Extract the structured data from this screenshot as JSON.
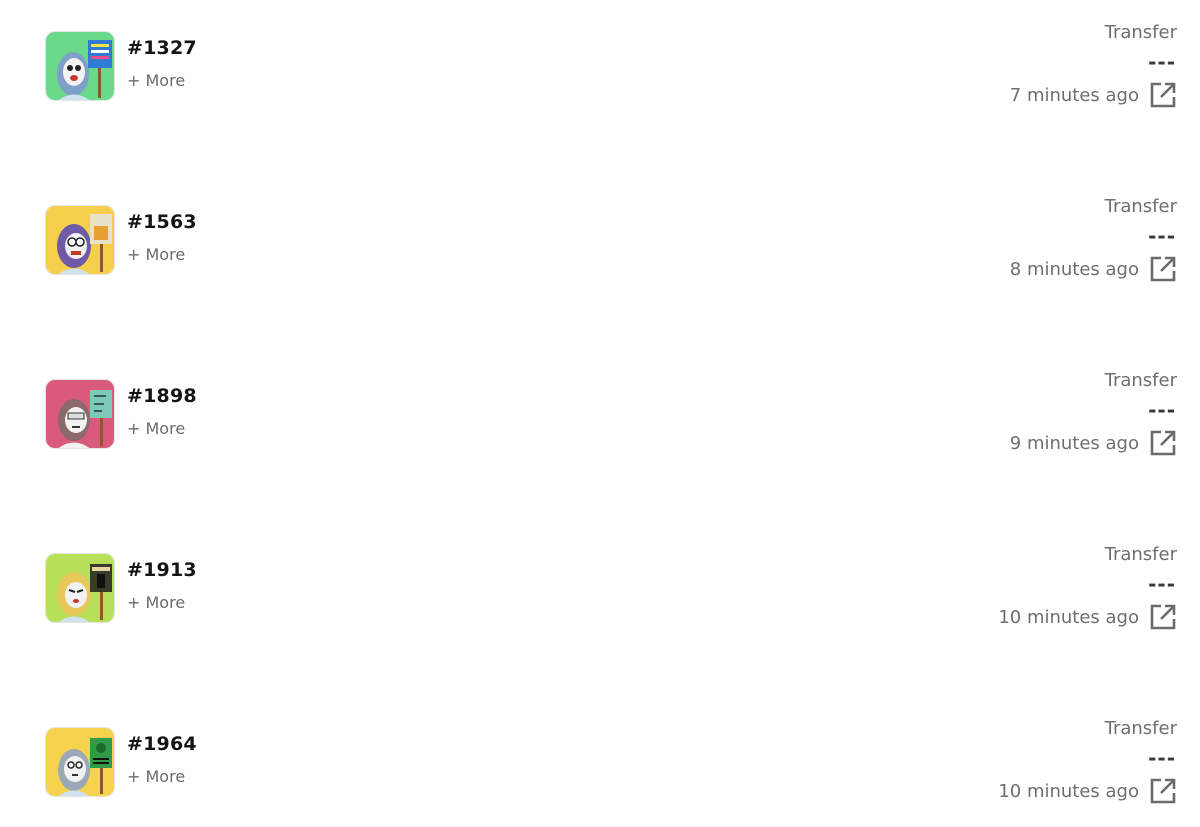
{
  "activity": [
    {
      "token": "#1327",
      "more": "+ More",
      "event": "Transfer",
      "price": "---",
      "time": "7 minutes ago",
      "bg": "#6ad98a",
      "hair": "#7fa0c8",
      "sign": "#2f7bd6",
      "icon": "external-link-icon"
    },
    {
      "token": "#1563",
      "more": "+ More",
      "event": "Transfer",
      "price": "---",
      "time": "8 minutes ago",
      "bg": "#f5cf4b",
      "hair": "#6e5aa6",
      "sign": "#e8e2c8",
      "icon": "external-link-icon"
    },
    {
      "token": "#1898",
      "more": "+ More",
      "event": "Transfer",
      "price": "---",
      "time": "9 minutes ago",
      "bg": "#d95a7a",
      "hair": "#8a6a6a",
      "sign": "#7ec8b8",
      "icon": "external-link-icon"
    },
    {
      "token": "#1913",
      "more": "+ More",
      "event": "Transfer",
      "price": "---",
      "time": "10 minutes ago",
      "bg": "#b6df5a",
      "hair": "#e8c85a",
      "sign": "#3a3a2a",
      "icon": "external-link-icon"
    },
    {
      "token": "#1964",
      "more": "+ More",
      "event": "Transfer",
      "price": "---",
      "time": "10 minutes ago",
      "bg": "#f5d34e",
      "hair": "#9aa8b8",
      "sign": "#2f9a4a",
      "icon": "external-link-icon"
    }
  ]
}
